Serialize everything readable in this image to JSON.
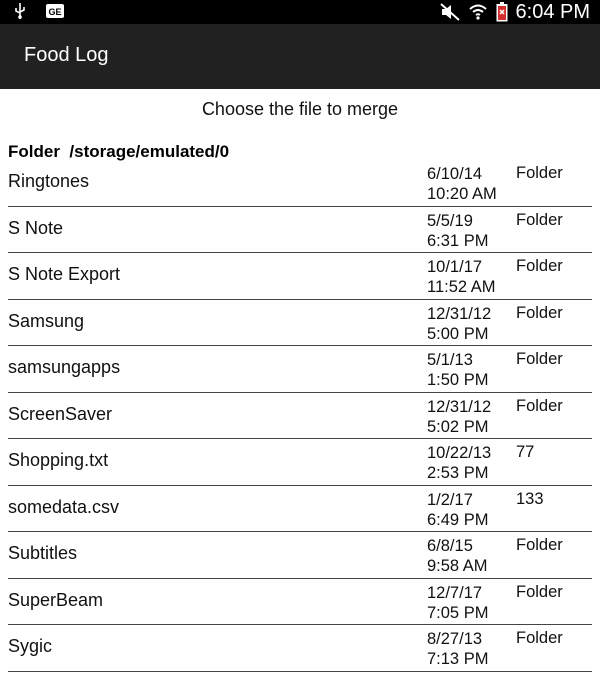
{
  "status_bar": {
    "left_icons": [
      "usb-icon",
      "gallery-icon"
    ],
    "right_icons": [
      "mute-icon",
      "wifi-icon",
      "battery-icon"
    ],
    "time": "6:04 PM"
  },
  "app_bar": {
    "title": "Food Log"
  },
  "dialog": {
    "prompt": "Choose the file to merge",
    "folder_label": "Folder",
    "folder_path": "/storage/emulated/0"
  },
  "files": [
    {
      "name": "Ringtones",
      "date": "6/10/14",
      "time": "10:20 AM",
      "size": "Folder"
    },
    {
      "name": "S Note",
      "date": "5/5/19",
      "time": "6:31 PM",
      "size": "Folder"
    },
    {
      "name": "S Note Export",
      "date": "10/1/17",
      "time": "11:52 AM",
      "size": "Folder"
    },
    {
      "name": "Samsung",
      "date": "12/31/12",
      "time": "5:00 PM",
      "size": "Folder"
    },
    {
      "name": "samsungapps",
      "date": "5/1/13",
      "time": "1:50 PM",
      "size": "Folder"
    },
    {
      "name": "ScreenSaver",
      "date": "12/31/12",
      "time": "5:02 PM",
      "size": "Folder"
    },
    {
      "name": "Shopping.txt",
      "date": "10/22/13",
      "time": "2:53 PM",
      "size": "77"
    },
    {
      "name": "somedata.csv",
      "date": "1/2/17",
      "time": "6:49 PM",
      "size": "133"
    },
    {
      "name": "Subtitles",
      "date": "6/8/15",
      "time": "9:58 AM",
      "size": "Folder"
    },
    {
      "name": "SuperBeam",
      "date": "12/7/17",
      "time": "7:05 PM",
      "size": "Folder"
    },
    {
      "name": "Sygic",
      "date": "8/27/13",
      "time": "7:13 PM",
      "size": "Folder"
    }
  ]
}
